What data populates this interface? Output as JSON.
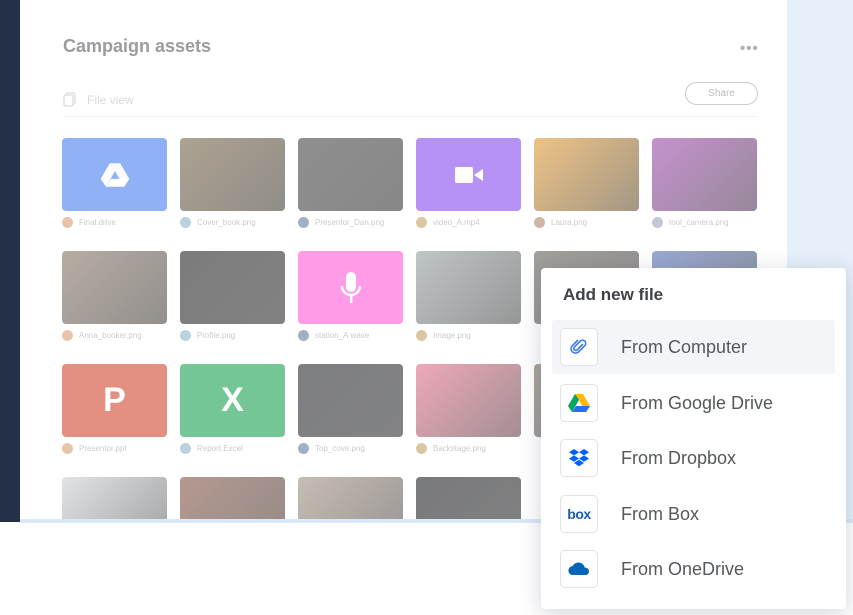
{
  "panel": {
    "title": "Campaign assets",
    "more_label": "•••",
    "file_view_label": "File view",
    "share_label": "Share"
  },
  "files": [
    {
      "name": "Final.drive",
      "kind": "drive",
      "color": "#4d82f1"
    },
    {
      "name": "Cover_book.png",
      "kind": "photo",
      "color": "#7b6a4e"
    },
    {
      "name": "Presentor_Dan.png",
      "kind": "photo",
      "color": "#4b4b4b"
    },
    {
      "name": "video_A.mp4",
      "kind": "video",
      "color": "#8a4ef0"
    },
    {
      "name": "Laura.png",
      "kind": "photo",
      "color": "#e39f39"
    },
    {
      "name": "tool_camera.png",
      "kind": "photo",
      "color": "#a24fb0"
    },
    {
      "name": "Anna_booker.png",
      "kind": "photo",
      "color": "#8a7a6a"
    },
    {
      "name": "Profile.png",
      "kind": "photo",
      "color": "#2c2c2c"
    },
    {
      "name": "station_A.wave",
      "kind": "audio",
      "color": "#ff5ed8"
    },
    {
      "name": "Image.png",
      "kind": "photo",
      "color": "#9aa1a3"
    },
    {
      "name": "",
      "kind": "photo",
      "color": "#6b6660"
    },
    {
      "name": "",
      "kind": "photo",
      "color": "#5c74b8"
    },
    {
      "name": "Presentor.ppt",
      "kind": "ppt",
      "color": "#d24d37"
    },
    {
      "name": "Report.Excel",
      "kind": "excel",
      "color": "#21a456"
    },
    {
      "name": "Top_cove.png",
      "kind": "photo",
      "color": "#2f3136"
    },
    {
      "name": "Backstage.png",
      "kind": "photo",
      "color": "#e4748e"
    },
    {
      "name": "",
      "kind": "photo",
      "color": "#7a6e62"
    },
    {
      "name": "",
      "kind": "photo",
      "color": "#5a6a92"
    },
    {
      "name": "",
      "kind": "photo",
      "color": "#cfd3d6"
    },
    {
      "name": "",
      "kind": "photo",
      "color": "#8a5a4c"
    },
    {
      "name": "",
      "kind": "photo",
      "color": "#a49486"
    },
    {
      "name": "",
      "kind": "photo",
      "color": "#27282b"
    }
  ],
  "popup": {
    "title": "Add new file",
    "options": [
      {
        "label": "From Computer",
        "icon": "paperclip-icon"
      },
      {
        "label": "From Google Drive",
        "icon": "google-drive-icon"
      },
      {
        "label": "From Dropbox",
        "icon": "dropbox-icon"
      },
      {
        "label": "From Box",
        "icon": "box-icon"
      },
      {
        "label": "From OneDrive",
        "icon": "onedrive-icon"
      }
    ]
  },
  "colors": {
    "sidebar": "#243048",
    "accent": "#4d82f1",
    "dropbox": "#0061fe",
    "onedrive": "#0364b8",
    "box": "#1a5fb4"
  }
}
